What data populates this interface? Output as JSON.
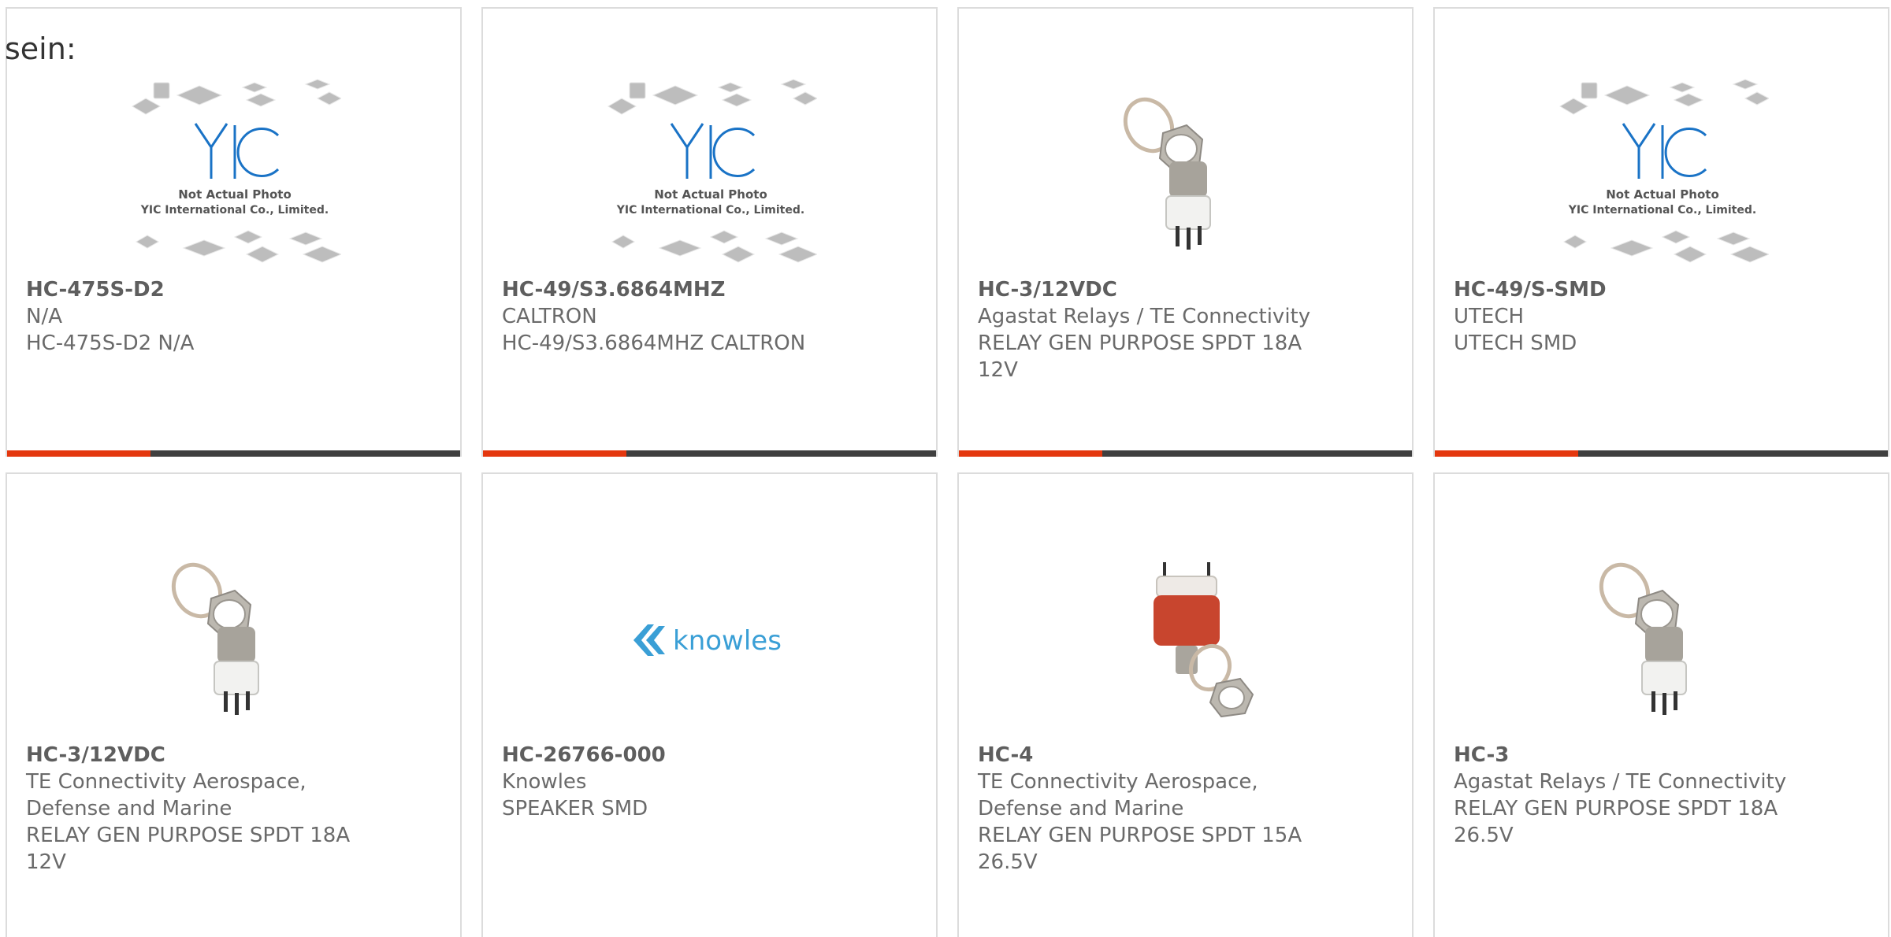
{
  "corner_text": "sein:",
  "colors": {
    "accent": "#e4370e",
    "bar": "#3f3f3f",
    "border": "#dcdcdc",
    "yic_blue": "#1a73c6",
    "knowles_blue": "#3a9fd6",
    "relay_red": "#c8452e"
  },
  "placeholder": {
    "logo": "YIC",
    "line1": "Not Actual Photo",
    "line2": "YIC International Co., Limited."
  },
  "knowles_logo": "knowles",
  "products": [
    {
      "part": "HC-475S-D2",
      "lines": [
        "N/A",
        "HC-475S-D2 N/A"
      ],
      "image": "yic-placeholder"
    },
    {
      "part": "HC-49/S3.6864MHZ",
      "lines": [
        "CALTRON",
        "HC-49/S3.6864MHZ CALTRON"
      ],
      "image": "yic-placeholder"
    },
    {
      "part": "HC-3/12VDC",
      "lines": [
        "Agastat Relays / TE Connectivity",
        "RELAY GEN PURPOSE SPDT 18A\n12V"
      ],
      "image": "relay-silver"
    },
    {
      "part": "HC-49/S-SMD",
      "lines": [
        "UTECH",
        "UTECH SMD"
      ],
      "image": "yic-placeholder"
    },
    {
      "part": "HC-3/12VDC",
      "lines": [
        "TE Connectivity Aerospace,\nDefense and Marine",
        "RELAY GEN PURPOSE SPDT 18A\n12V"
      ],
      "image": "relay-silver"
    },
    {
      "part": "HC-26766-000",
      "lines": [
        "Knowles",
        "SPEAKER SMD"
      ],
      "image": "knowles-logo"
    },
    {
      "part": "HC-4",
      "lines": [
        "TE Connectivity Aerospace,\nDefense and Marine",
        "RELAY GEN PURPOSE SPDT 15A\n26.5V"
      ],
      "image": "relay-red"
    },
    {
      "part": "HC-3",
      "lines": [
        "Agastat Relays / TE Connectivity",
        "RELAY GEN PURPOSE SPDT 18A\n26.5V"
      ],
      "image": "relay-silver"
    }
  ]
}
